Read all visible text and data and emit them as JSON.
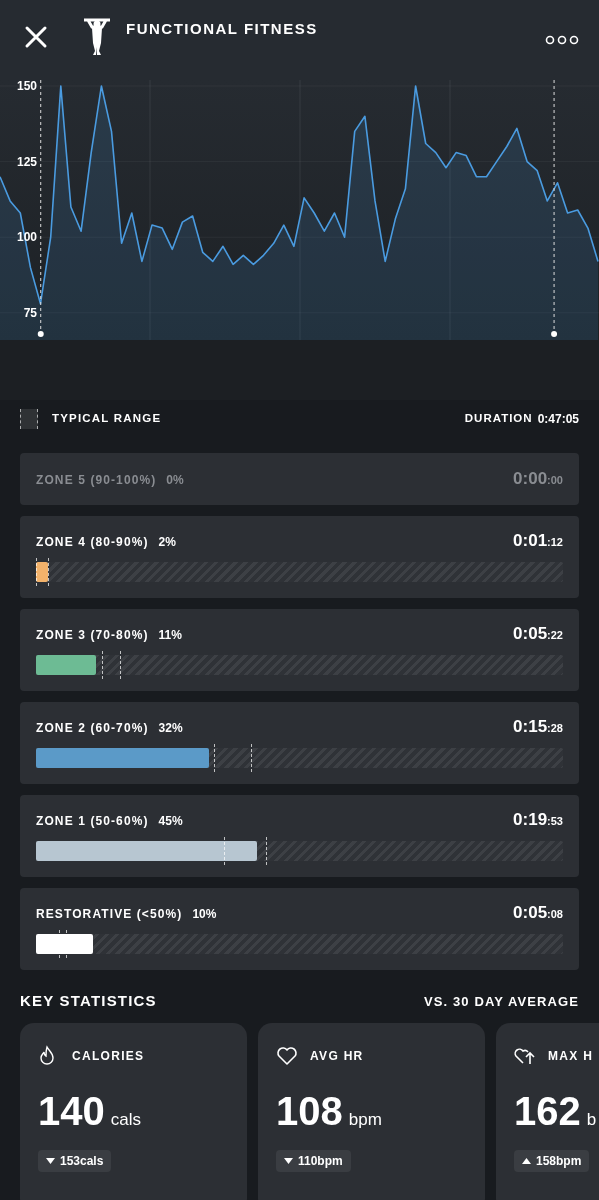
{
  "header": {
    "title": "FUNCTIONAL FITNESS"
  },
  "chart": {
    "chart_data": {
      "type": "area",
      "ylim": [
        66,
        152
      ],
      "yticks": [
        75,
        100,
        125,
        150
      ],
      "grid": true,
      "series": [
        {
          "color": "#4a9be0",
          "values": [
            120,
            112,
            108,
            90,
            78,
            100,
            150,
            110,
            102,
            128,
            150,
            135,
            98,
            108,
            92,
            104,
            103,
            96,
            105,
            107,
            95,
            92,
            97,
            91,
            94,
            91,
            94,
            98,
            104,
            97,
            113,
            108,
            102,
            108,
            100,
            135,
            140,
            112,
            92,
            106,
            116,
            150,
            131,
            128,
            123,
            128,
            127,
            120,
            120,
            125,
            130,
            136,
            125,
            122,
            112,
            118,
            108,
            109,
            103,
            92
          ]
        }
      ]
    }
  },
  "legend": {
    "label": "TYPICAL RANGE",
    "duration_label": "DURATION",
    "duration": "0:47:05"
  },
  "zones": [
    {
      "name": "ZONE 5 (90-100%)",
      "percent": "0%",
      "time": "0:00",
      "seconds": ":00",
      "disabled": true
    },
    {
      "name": "ZONE 4 (80-90%)",
      "percent": "2%",
      "time": "0:01",
      "seconds": ":12",
      "disabled": false,
      "level": 0.023,
      "color": "#f2b26b"
    },
    {
      "name": "ZONE 3 (70-80%)",
      "percent": "11%",
      "time": "0:05",
      "seconds": ":22",
      "disabled": false,
      "level": 0.113,
      "color": "#6dbb94"
    },
    {
      "name": "ZONE 2 (60-70%)",
      "percent": "32%",
      "time": "0:15",
      "seconds": ":28",
      "disabled": false,
      "level": 0.328,
      "color": "#5b9ac8"
    },
    {
      "name": "ZONE 1 (50-60%)",
      "percent": "45%",
      "time": "0:19",
      "seconds": ":53",
      "disabled": false,
      "level": 0.42,
      "color": "#b7c6d1"
    },
    {
      "name": "RESTORATIVE (<50%)",
      "percent": "10%",
      "time": "0:05",
      "seconds": ":08",
      "disabled": false,
      "level": 0.108,
      "color": "#ffffff"
    }
  ],
  "key_statistics": {
    "title": "KEY STATISTICS",
    "comparison": "VS. 30 DAY AVERAGE",
    "cards": [
      {
        "kind": "flame",
        "label": "CALORIES",
        "value": "140",
        "unit": "cals",
        "average": "153cals",
        "above_average": false
      },
      {
        "kind": "heart",
        "label": "AVG HR",
        "value": "108",
        "unit": "bpm",
        "average": "110bpm",
        "above_average": false
      },
      {
        "kind": "heart-up",
        "label": "MAX H",
        "value": "162",
        "unit": "b",
        "average": "158bpm",
        "above_average": true
      }
    ]
  }
}
